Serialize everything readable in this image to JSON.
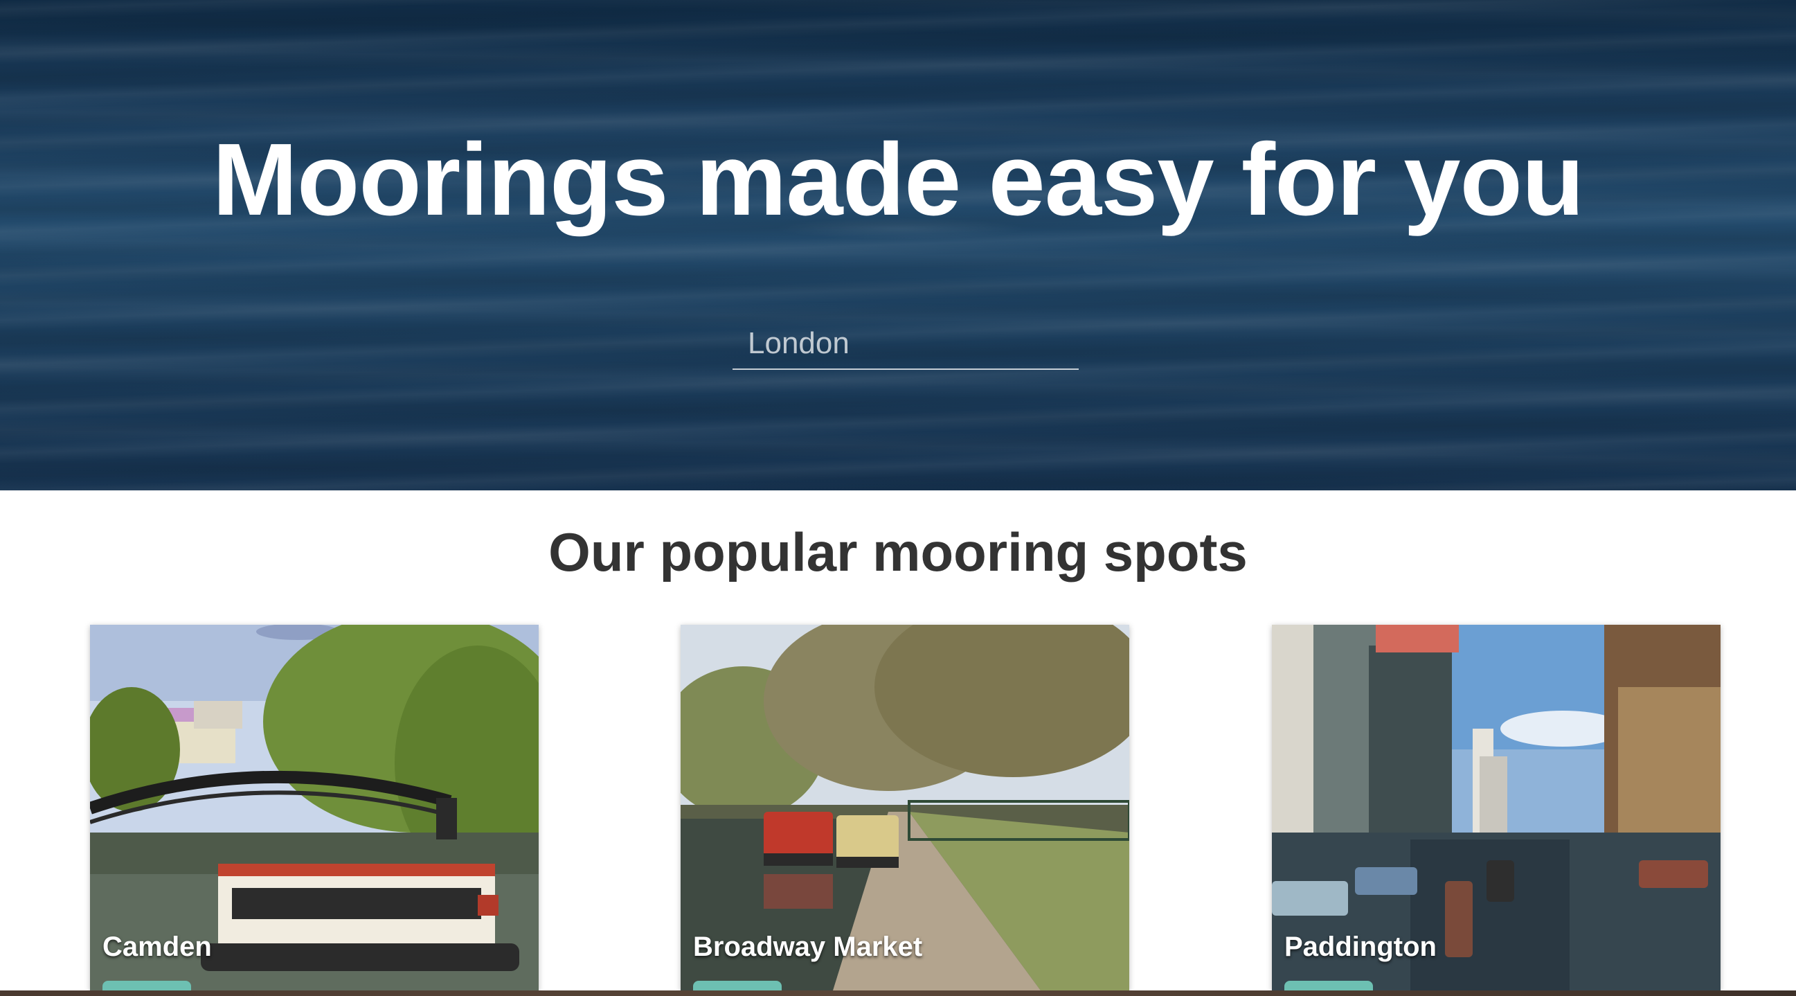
{
  "hero": {
    "title": "Moorings made easy for you",
    "search": {
      "placeholder": "London"
    }
  },
  "section": {
    "title": "Our popular mooring spots"
  },
  "spots": [
    {
      "name": "Camden"
    },
    {
      "name": "Broadway Market"
    },
    {
      "name": "Paddington"
    }
  ],
  "colors": {
    "hero_water": "#1a3b5a",
    "heading": "#333333",
    "badge": "#6dc0b2"
  }
}
